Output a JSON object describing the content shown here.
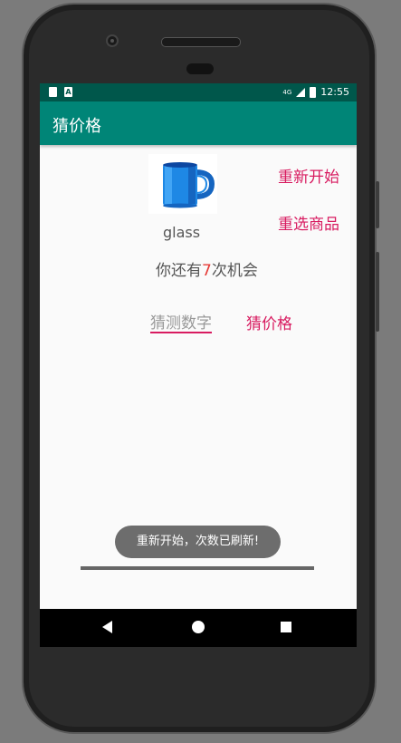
{
  "status_bar": {
    "network": "4G",
    "time": "12:55",
    "notification_icon_2": "A"
  },
  "app_bar": {
    "title": "猜价格"
  },
  "product": {
    "image_icon": "blue-mug-icon",
    "name": "glass"
  },
  "chances": {
    "prefix": "你还有",
    "count": "7",
    "suffix": "次机会",
    "count_color": "#e53935"
  },
  "buttons": {
    "restart": "重新开始",
    "reselect": "重选商品",
    "guess": "猜价格"
  },
  "guess_input": {
    "placeholder": "猜测数字",
    "value": ""
  },
  "toast": {
    "message": "重新开始，次数已刷新!"
  },
  "colors": {
    "accent": "#d81b60",
    "primary": "#008577",
    "primary_dark": "#00574b"
  }
}
